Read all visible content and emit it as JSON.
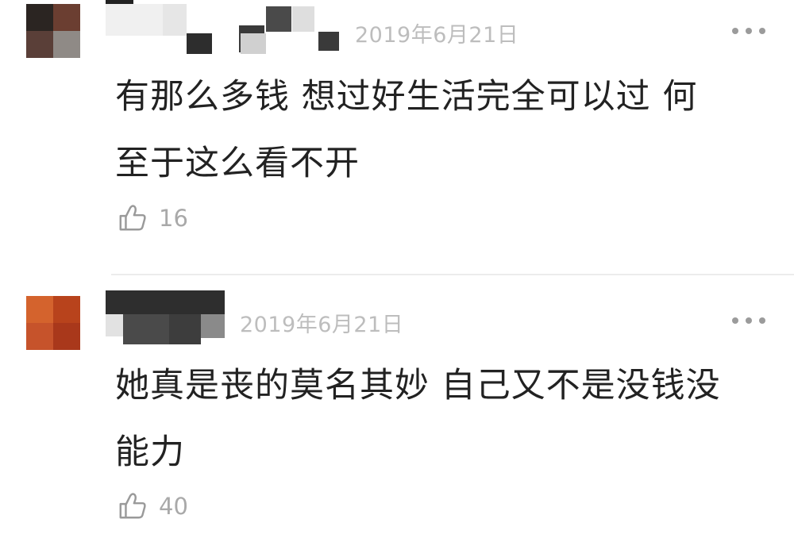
{
  "comments": [
    {
      "timestamp": "2019年6月21日",
      "text": "有那么多钱 想过好生活完全可以过 何\n至于这么看不开",
      "likes": "16",
      "more_icon": "ellipsis-icon",
      "like_icon": "thumbs-up-icon",
      "avatar_colors": [
        "#2b2522",
        "#6b3e31",
        "#5a3f38",
        "#8f8a86"
      ]
    },
    {
      "timestamp": "2019年6月21日",
      "text": "她真是丧的莫名其妙 自己又不是没钱没\n能力",
      "likes": "40",
      "more_icon": "ellipsis-icon",
      "like_icon": "thumbs-up-icon",
      "avatar_colors": [
        "#d4632d",
        "#b8431c",
        "#c6532b",
        "#a9381b"
      ]
    }
  ],
  "colors": {
    "timestamp": "#bdbdbd",
    "body_text": "#222222",
    "like_count": "#a9a9a9",
    "divider": "#ececec"
  }
}
